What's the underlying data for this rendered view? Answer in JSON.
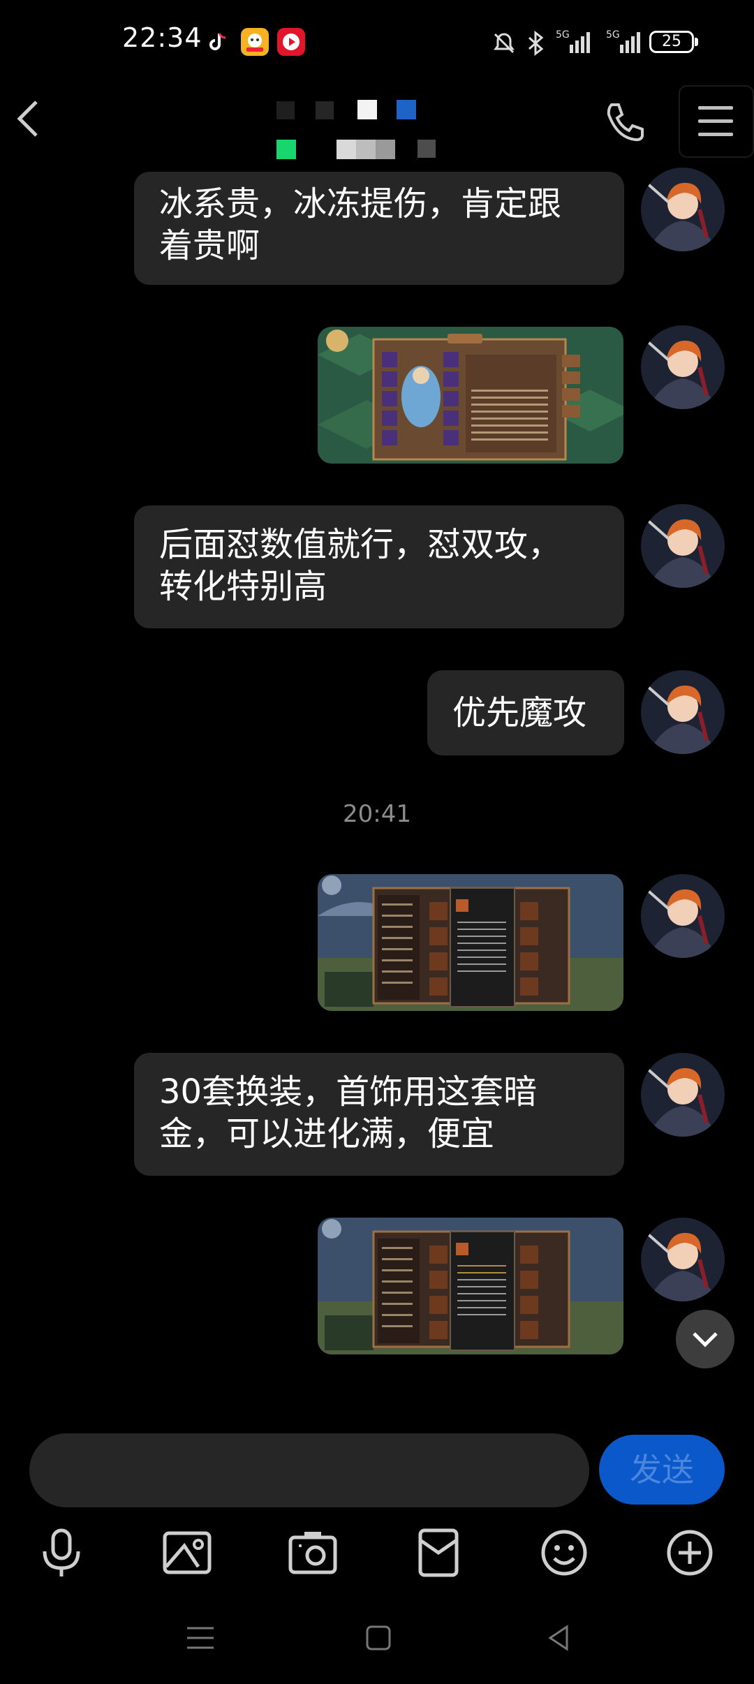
{
  "status_bar": {
    "time": "22:34",
    "network": "5G",
    "battery": "25",
    "app_icons": [
      "tiktok-lite-icon",
      "game-app-icon",
      "video-app-icon"
    ]
  },
  "header": {
    "icons": [
      "back-arrow-icon",
      "phone-icon",
      "menu-icon"
    ]
  },
  "messages": [
    {
      "type": "text",
      "text_lines": [
        "冰系贵，冰冻提伤，肯定跟",
        "着贵啊"
      ]
    },
    {
      "type": "image"
    },
    {
      "type": "text",
      "text_lines": [
        "后面怼数值就行，怼双攻，",
        "转化特别高"
      ]
    },
    {
      "type": "text",
      "text_lines": [
        "优先魔攻"
      ]
    },
    {
      "type": "timestamp",
      "text": "20:41"
    },
    {
      "type": "image"
    },
    {
      "type": "text",
      "text_lines": [
        "30套换装，首饰用这套暗",
        "金，可以进化满，便宜"
      ]
    },
    {
      "type": "image"
    }
  ],
  "input": {
    "value": "",
    "send_label": "发送"
  },
  "toolbar": {
    "icons": [
      "microphone-icon",
      "image-icon",
      "camera-icon",
      "red-packet-icon",
      "emoji-icon",
      "plus-icon"
    ]
  },
  "colors": {
    "background": "#000000",
    "bubble": "#262626",
    "send": "#0a58c9"
  }
}
